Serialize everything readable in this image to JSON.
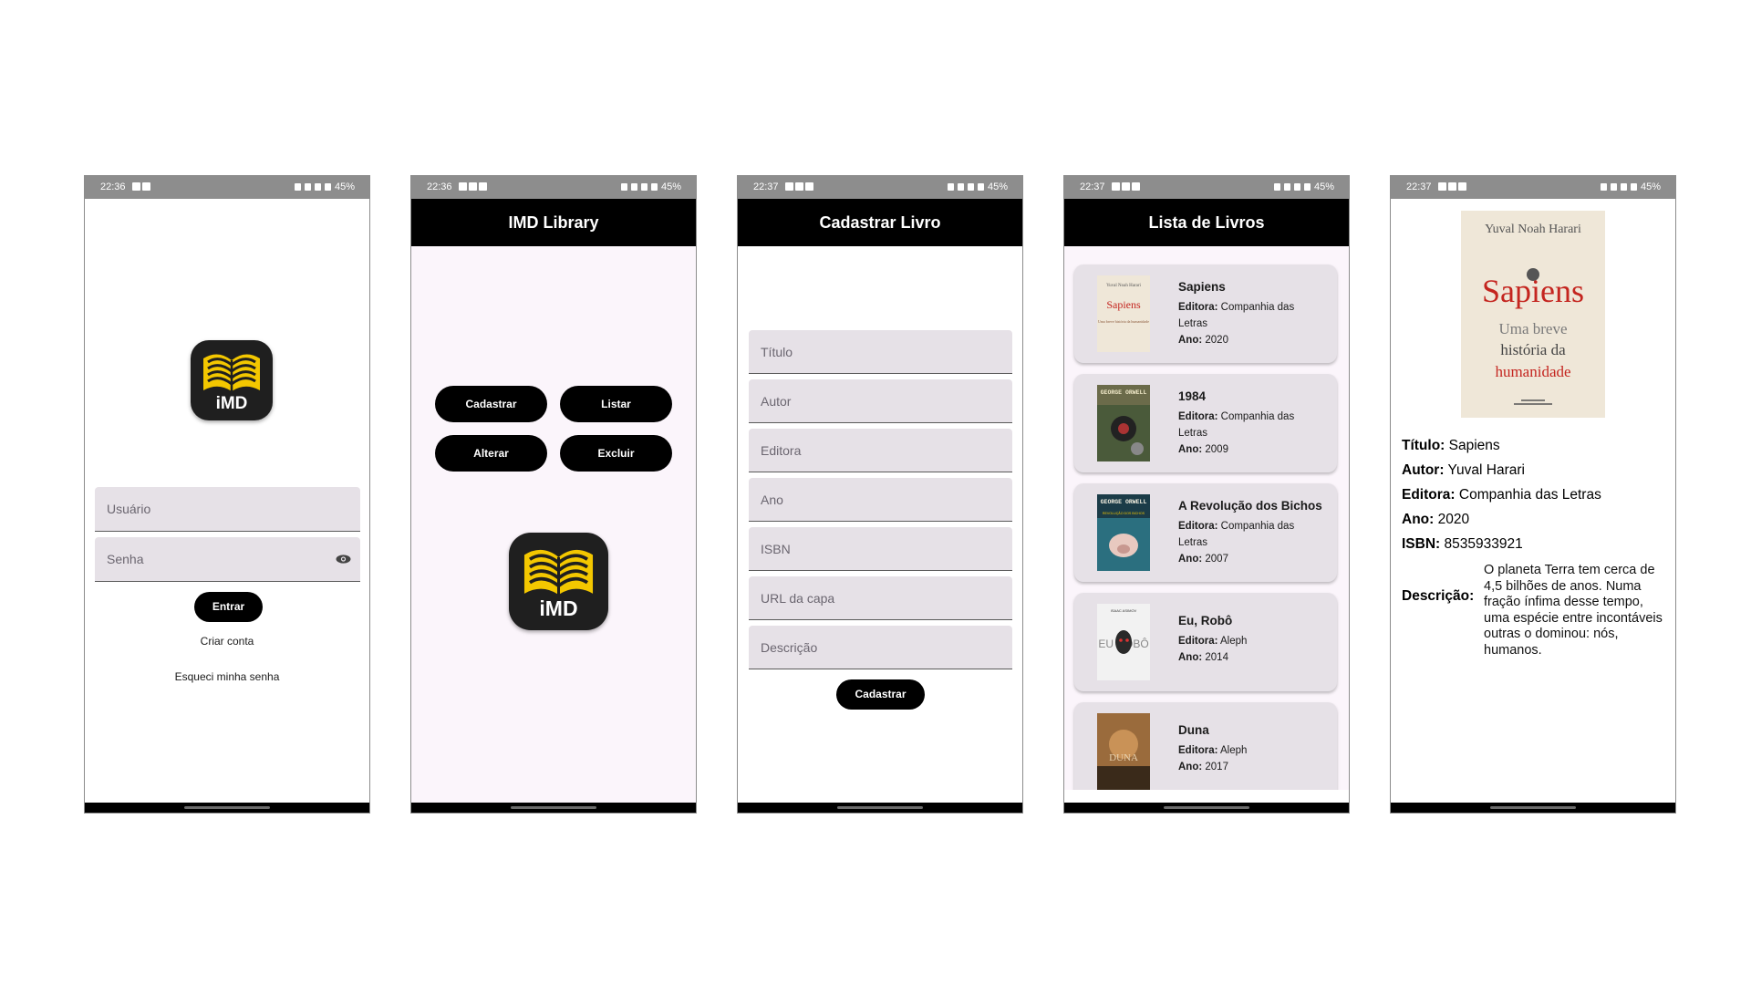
{
  "status": {
    "time_login": "22:36",
    "time_menu": "22:36",
    "time_form": "22:37",
    "time_list": "22:37",
    "time_detail": "22:37",
    "battery": "45%"
  },
  "login": {
    "logo_text": "iMD",
    "username_placeholder": "Usuário",
    "password_placeholder": "Senha",
    "enter_button": "Entrar",
    "create_account": "Criar conta",
    "forgot_password": "Esqueci minha senha"
  },
  "menu": {
    "title": "IMD Library",
    "buttons": [
      "Cadastrar",
      "Listar",
      "Alterar",
      "Excluir"
    ],
    "logo_text": "iMD"
  },
  "form": {
    "title": "Cadastrar Livro",
    "fields": [
      "Título",
      "Autor",
      "Editora",
      "Ano",
      "ISBN",
      "URL da capa",
      "Descrição"
    ],
    "submit_button": "Cadastrar"
  },
  "list": {
    "title": "Lista de Livros",
    "publisher_label": "Editora:",
    "year_label": "Ano:",
    "books": [
      {
        "title": "Sapiens",
        "publisher": "Companhia das Letras",
        "year": "2020",
        "cover_color": "#efe7d8",
        "cover_text_1": "Yuval Noah Harari",
        "cover_text_2": "Sapiens",
        "cover_text_3": "Uma breve história da humanidade"
      },
      {
        "title": "1984",
        "publisher": "Companhia das Letras",
        "year": "2009",
        "cover_color": "#4a5a3a",
        "cover_text_1": "GEORGE ORWELL"
      },
      {
        "title": "A Revolução dos Bichos",
        "publisher": "Companhia das Letras",
        "year": "2007",
        "cover_color": "#2b6f7f",
        "cover_text_1": "GEORGE ORWELL",
        "cover_text_2": "REVOLUÇÃO DOS BICHOS"
      },
      {
        "title": "Eu, Robô",
        "publisher": "Aleph",
        "year": "2014",
        "cover_color": "#f2f2f2",
        "cover_text_1": "ISAAC ASIMOV",
        "cover_text_2": "EU ROBÔ"
      },
      {
        "title": "Duna",
        "publisher": "Aleph",
        "year": "2017",
        "cover_color": "#9a6b3c",
        "cover_text_1": "DUNA"
      }
    ]
  },
  "detail": {
    "cover": {
      "author": "Yuval Noah Harari",
      "title": "Sapiens",
      "subtitle_1": "Uma breve",
      "subtitle_2": "história da",
      "subtitle_3": "humanidade"
    },
    "title_label": "Título:",
    "title": "Sapiens",
    "author_label": "Autor:",
    "author": "Yuval Harari",
    "publisher_label": "Editora:",
    "publisher": "Companhia das Letras",
    "year_label": "Ano:",
    "year": "2020",
    "isbn_label": "ISBN:",
    "isbn": "8535933921",
    "description_label": "Descrição:",
    "description": "O planeta Terra tem cerca de 4,5 bilhões de anos. Numa fração ínfima desse tempo, uma espécie entre incontáveis outras o dominou: nós, humanos."
  },
  "colors": {
    "appbar": "#000000",
    "menu_background": "#fbf5fb",
    "field_background": "#e6e1e7",
    "card_background": "#e6e1e7",
    "logo_yellow": "#f3c700",
    "sapiens_red": "#c4251f"
  }
}
